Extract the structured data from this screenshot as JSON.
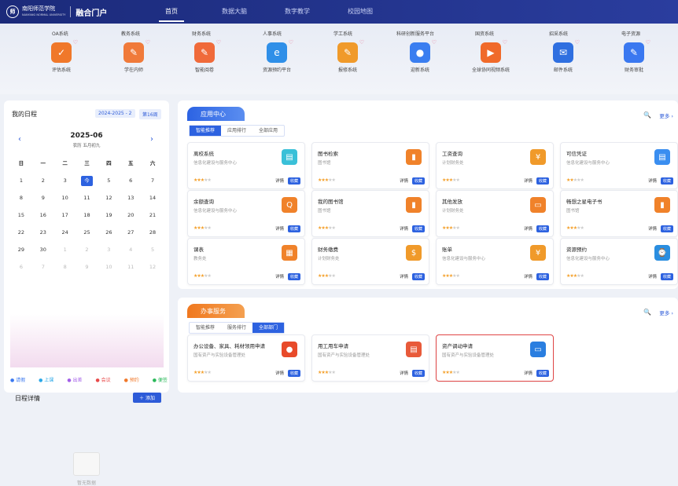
{
  "header": {
    "school_name": "南阳师范学院",
    "school_sub": "NANYANG NORMAL UNIVERSITY",
    "portal": "融合门户",
    "nav": [
      "首页",
      "数据大脑",
      "数字教学",
      "校园地图"
    ]
  },
  "systems_top": [
    "OA系统",
    "教务系统",
    "财务系统",
    "人事系统",
    "学工系统",
    "科研创新服务平台",
    "国资系统",
    "招采系统",
    "电子资源"
  ],
  "systems": [
    {
      "label": "评估系统",
      "color": "#f0782a",
      "icon": "✓"
    },
    {
      "label": "学在内师",
      "color": "#f07a3a",
      "icon": "✎"
    },
    {
      "label": "智能阅卷",
      "color": "#f06a3a",
      "icon": "✎"
    },
    {
      "label": "资源预约平台",
      "color": "#2f8fe8",
      "icon": "e"
    },
    {
      "label": "报修系统",
      "color": "#f09a2a",
      "icon": "✎"
    },
    {
      "label": "迎新系统",
      "color": "#3a7ef0",
      "icon": "●"
    },
    {
      "label": "全球协同视频系统",
      "color": "#f06a2a",
      "icon": "▶"
    },
    {
      "label": "邮件系统",
      "color": "#2f6fe0",
      "icon": "✉"
    },
    {
      "label": "财务审批",
      "color": "#3a78f0",
      "icon": "✎"
    }
  ],
  "schedule": {
    "title": "我的日程",
    "term": "2024-2025 - 2",
    "week": "第16周",
    "month": "2025-06",
    "lunar": "农历 五月初九",
    "weekdays": [
      "日",
      "一",
      "二",
      "三",
      "四",
      "五",
      "六"
    ],
    "days": [
      "1",
      "2",
      "3",
      "今",
      "5",
      "6",
      "7",
      "8",
      "9",
      "10",
      "11",
      "12",
      "13",
      "14",
      "15",
      "16",
      "17",
      "18",
      "19",
      "20",
      "21",
      "22",
      "23",
      "24",
      "25",
      "26",
      "27",
      "28",
      "29",
      "30",
      "1",
      "2",
      "3",
      "4",
      "5",
      "6",
      "7",
      "8",
      "9",
      "10",
      "11",
      "12"
    ],
    "legend": [
      {
        "t": "● 请假",
        "c": "#3a78f0"
      },
      {
        "t": "● 上课",
        "c": "#2aa8e8"
      },
      {
        "t": "● 出差",
        "c": "#a35fe8"
      },
      {
        "t": "● 会议",
        "c": "#e84a4a"
      },
      {
        "t": "● 预约",
        "c": "#f0782a"
      },
      {
        "t": "● 便签",
        "c": "#2ab85a"
      }
    ],
    "detail_title": "日程详情",
    "add_label": "＋ 添加",
    "empty": "暂无数据"
  },
  "app_center": {
    "title": "应用中心",
    "tabs": [
      "智能推荐",
      "应用排行",
      "全部应用"
    ],
    "search": "🔍",
    "more": "更多 ›",
    "cards": [
      {
        "title": "离校系统",
        "sub": "信息化建设与服务中心",
        "color": "#3ac0d8",
        "icon": "▤",
        "stars": 3
      },
      {
        "title": "图书检索",
        "sub": "图书馆",
        "color": "#f0822a",
        "icon": "▮",
        "stars": 3
      },
      {
        "title": "工资查询",
        "sub": "计划财务处",
        "color": "#f09a2a",
        "icon": "¥",
        "stars": 3
      },
      {
        "title": "可信凭证",
        "sub": "信息化建设与服务中心",
        "color": "#3a8ef0",
        "icon": "▤",
        "stars": 2
      },
      {
        "title": "余额查询",
        "sub": "信息化建设与服务中心",
        "color": "#f0822a",
        "icon": "Q",
        "stars": 3
      },
      {
        "title": "我的图书馆",
        "sub": "图书馆",
        "color": "#f0822a",
        "icon": "▮",
        "stars": 3
      },
      {
        "title": "其他发放",
        "sub": "计划财务处",
        "color": "#f0822a",
        "icon": "▭",
        "stars": 3
      },
      {
        "title": "畅想之星电子书",
        "sub": "图书馆",
        "color": "#f0822a",
        "icon": "▮",
        "stars": 3
      },
      {
        "title": "课表",
        "sub": "教务处",
        "color": "#f0822a",
        "icon": "▦",
        "stars": 3
      },
      {
        "title": "财务缴费",
        "sub": "计划财务处",
        "color": "#f09a2a",
        "icon": "$",
        "stars": 3
      },
      {
        "title": "账单",
        "sub": "信息化建设与服务中心",
        "color": "#f09a2a",
        "icon": "¥",
        "stars": 3
      },
      {
        "title": "资源预约",
        "sub": "信息化建设与服务中心",
        "color": "#2a8ee0",
        "icon": "⌚",
        "stars": 3
      }
    ]
  },
  "service": {
    "title": "办事服务",
    "tabs": [
      "智能推荐",
      "服务排行",
      "全部部门"
    ],
    "search": "🔍",
    "more": "更多 ›",
    "cards": [
      {
        "title": "办公设备、家具、耗材领用申请",
        "sub": "国有资产与实验设备管理处",
        "color": "#e84a2a",
        "icon": "●",
        "stars": 3
      },
      {
        "title": "用工用车申请",
        "sub": "国有资产与实验设备管理处",
        "color": "#e85a3a",
        "icon": "▤",
        "stars": 3
      },
      {
        "title": "资产调动申请",
        "sub": "国有资产与实验设备管理处",
        "color": "#2a7ee0",
        "icon": "▭",
        "stars": 3
      }
    ]
  },
  "card_detail": "详情",
  "card_fav": "收藏"
}
